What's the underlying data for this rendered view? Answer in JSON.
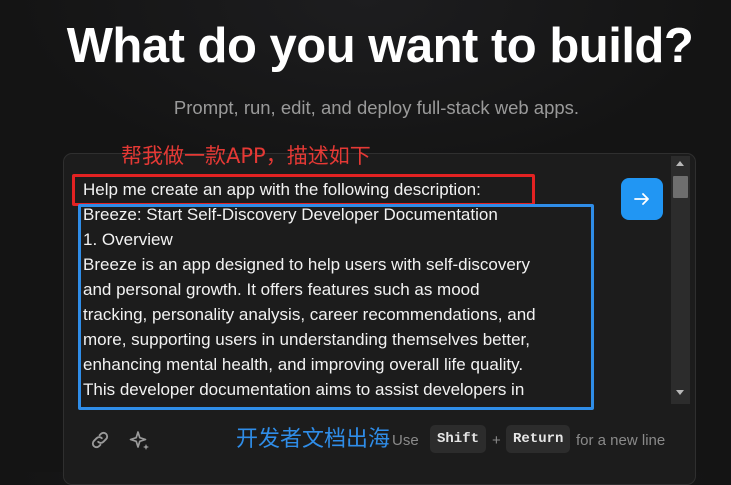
{
  "hero": {
    "title": "What do you want to build?",
    "subtitle": "Prompt, run, edit, and deploy full-stack web apps."
  },
  "annotations": {
    "top_label": "帮我做一款APP，描述如下",
    "bottom_label": "开发者文档出海",
    "red_color": "#e32222",
    "blue_color": "#2f8de8"
  },
  "prompt": {
    "lines": [
      "Help me create an app with the following description:",
      "Breeze: Start Self-Discovery Developer Documentation",
      "1. Overview",
      "Breeze is an app designed to help users with self-discovery",
      "and personal growth. It offers features such as mood",
      "tracking, personality analysis, career recommendations, and",
      "more, supporting users in understanding themselves better,",
      "enhancing mental health, and improving overall life quality.",
      "This developer documentation aims to assist developers in"
    ]
  },
  "toolbar": {
    "attach_icon": "link-icon",
    "enhance_icon": "sparkles-icon",
    "send_icon": "arrow-right-icon"
  },
  "hint": {
    "prefix": "Use",
    "key1": "Shift",
    "plus": "+",
    "key2": "Return",
    "suffix": "for a new line"
  },
  "colors": {
    "accent": "#2196f3",
    "background": "#141414"
  }
}
